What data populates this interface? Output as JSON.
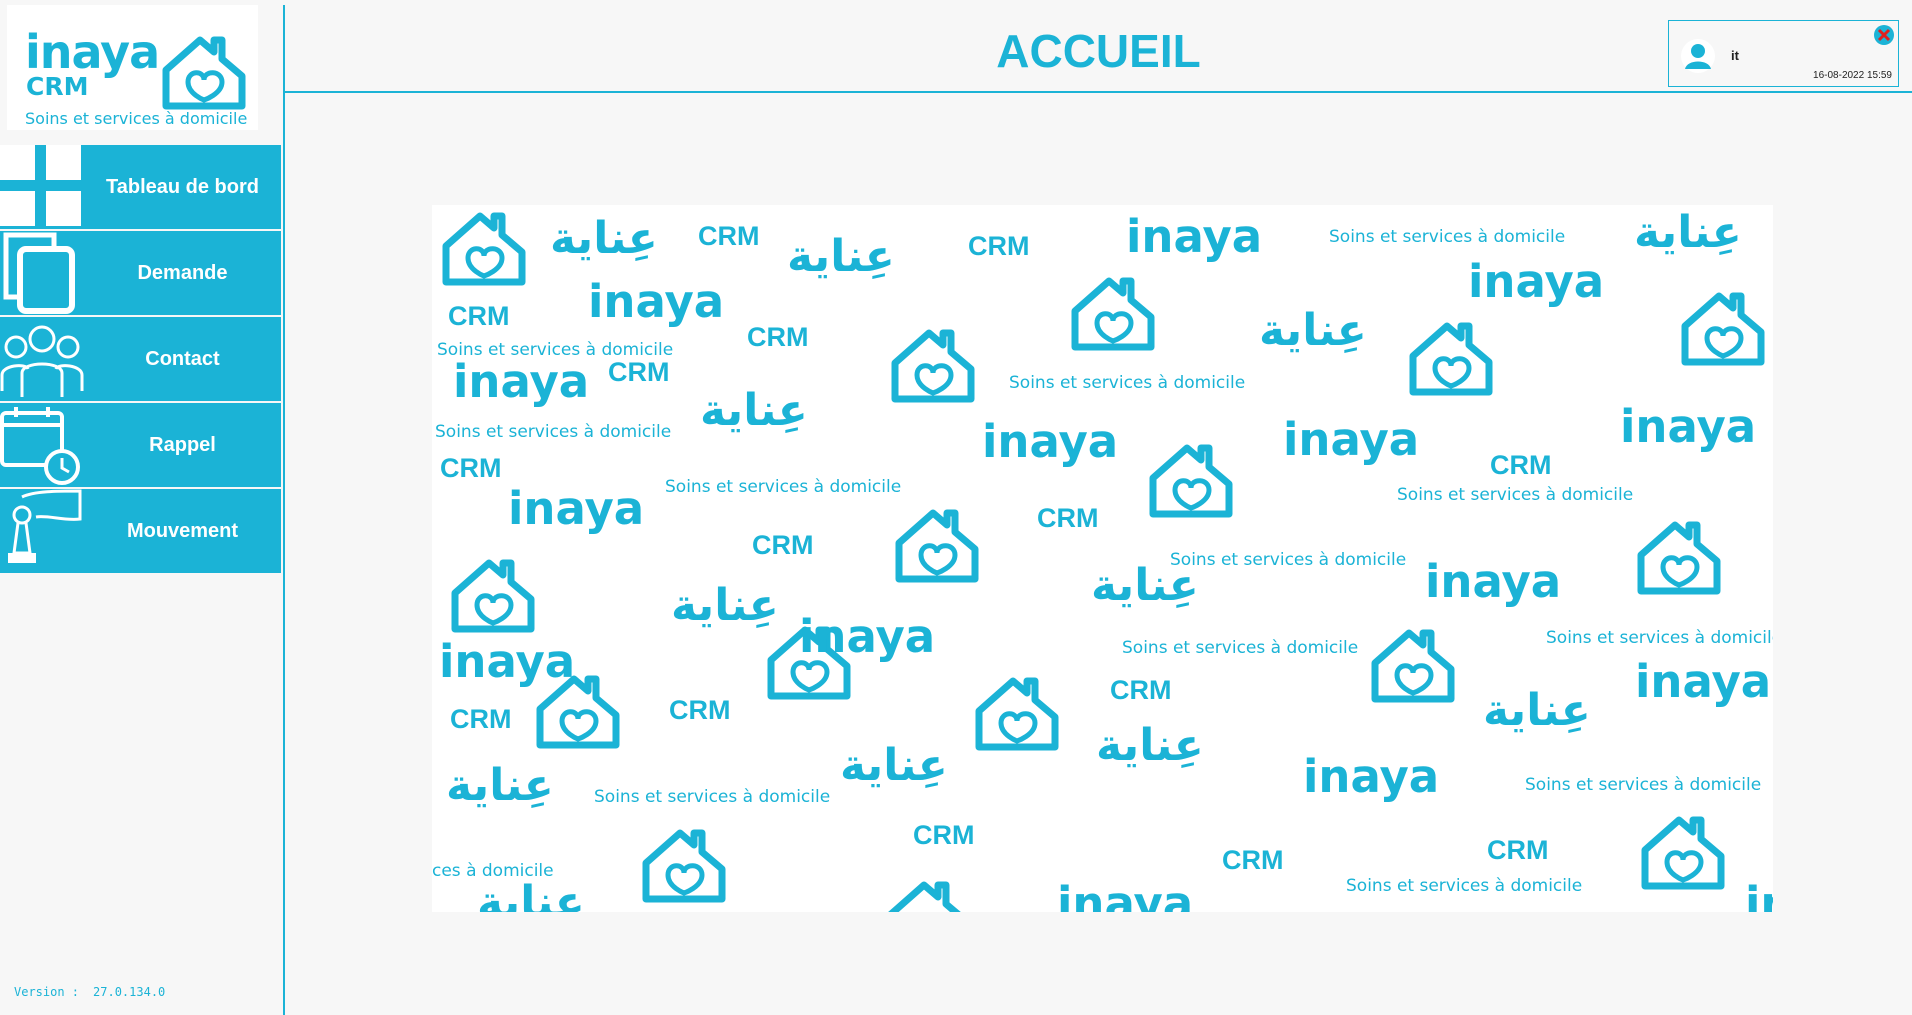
{
  "app": {
    "brand": "inaya",
    "crm": "CRM",
    "tagline": "Soins et services à domicile",
    "accent_color": "#1bb3d6"
  },
  "header": {
    "title": "ACCUEIL"
  },
  "user": {
    "name": "it",
    "datetime": "16-08-2022 15:59",
    "icon": "user-avatar-icon"
  },
  "close_icon": "close-icon",
  "sidebar": {
    "items": [
      {
        "label": "Tableau de bord",
        "icon": "dashboard-grid-icon"
      },
      {
        "label": "Demande",
        "icon": "documents-icon"
      },
      {
        "label": "Contact",
        "icon": "contacts-group-icon"
      },
      {
        "label": "Rappel",
        "icon": "calendar-alarm-icon"
      },
      {
        "label": "Mouvement",
        "icon": "chess-pawn-hand-icon"
      }
    ]
  },
  "version": {
    "label": "Version :",
    "value": "27.0.134.0"
  },
  "wallpaper": {
    "words": {
      "brand": "inaya",
      "crm": "CRM",
      "tagline": "Soins et services à domicile",
      "arabic": "عِناية",
      "tagline_cut": "ces à domicile"
    }
  }
}
